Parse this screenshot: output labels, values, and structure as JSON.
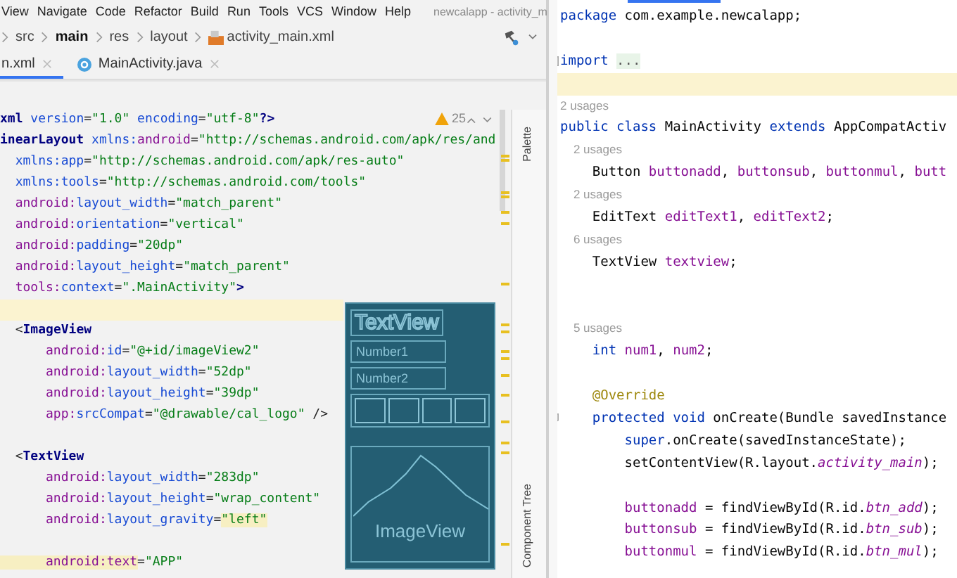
{
  "left_window": {
    "menu": [
      "View",
      "Navigate",
      "Code",
      "Refactor",
      "Build",
      "Run",
      "Tools",
      "VCS",
      "Window",
      "Help"
    ],
    "title": "newcalapp - activity_m",
    "breadcrumb": [
      {
        "label": "src",
        "emphasized": false
      },
      {
        "label": "main",
        "emphasized": true
      },
      {
        "label": "res",
        "emphasized": false
      },
      {
        "label": "layout",
        "emphasized": false
      },
      {
        "label": "activity_main.xml",
        "emphasized": false
      }
    ],
    "tabs": [
      {
        "label": "n.xml",
        "selected": true,
        "kind": "xml"
      },
      {
        "label": "MainActivity.java",
        "selected": false,
        "kind": "java"
      }
    ],
    "warnings": "25",
    "side_tools": [
      "Palette",
      "Component Tree"
    ],
    "lines": [
      {
        "kind": "code",
        "tokens": [
          {
            "text": "xml",
            "kind": "tag"
          },
          {
            "text": " version",
            "kind": "attr"
          },
          {
            "text": "=",
            "kind": "p"
          },
          {
            "text": "\"1.0\"",
            "kind": "str"
          },
          {
            "text": " encoding",
            "kind": "attr"
          },
          {
            "text": "=",
            "kind": "p"
          },
          {
            "text": "\"utf-8\"",
            "kind": "str"
          },
          {
            "text": "?>",
            "kind": "tag"
          }
        ]
      },
      {
        "kind": "code",
        "tokens": [
          {
            "text": "inearLayout",
            "kind": "tag"
          },
          {
            "text": " xmlns:",
            "kind": "attr"
          },
          {
            "text": "android",
            "kind": "ns"
          },
          {
            "text": "=",
            "kind": "p"
          },
          {
            "text": "\"http://schemas.android.com/apk/res/and",
            "kind": "str"
          }
        ]
      },
      {
        "kind": "code",
        "tokens": [
          {
            "text": "  xmlns:app",
            "kind": "attr"
          },
          {
            "text": "=",
            "kind": "p"
          },
          {
            "text": "\"http://schemas.android.com/apk/res-auto\"",
            "kind": "str"
          }
        ]
      },
      {
        "kind": "code",
        "tokens": [
          {
            "text": "  xmlns:tools",
            "kind": "attr"
          },
          {
            "text": "=",
            "kind": "p"
          },
          {
            "text": "\"http://schemas.android.com/tools\"",
            "kind": "str"
          }
        ]
      },
      {
        "kind": "code",
        "tokens": [
          {
            "text": "  android:",
            "kind": "ns"
          },
          {
            "text": "layout_width",
            "kind": "attr"
          },
          {
            "text": "=",
            "kind": "p"
          },
          {
            "text": "\"match_parent\"",
            "kind": "str"
          }
        ]
      },
      {
        "kind": "code",
        "tokens": [
          {
            "text": "  android:",
            "kind": "ns"
          },
          {
            "text": "orientation",
            "kind": "attr"
          },
          {
            "text": "=",
            "kind": "p"
          },
          {
            "text": "\"vertical\"",
            "kind": "str"
          }
        ]
      },
      {
        "kind": "code",
        "tokens": [
          {
            "text": "  android:",
            "kind": "ns"
          },
          {
            "text": "padding",
            "kind": "attr"
          },
          {
            "text": "=",
            "kind": "p"
          },
          {
            "text": "\"20dp\"",
            "kind": "str"
          }
        ]
      },
      {
        "kind": "code",
        "tokens": [
          {
            "text": "  android:",
            "kind": "ns"
          },
          {
            "text": "layout_height",
            "kind": "attr"
          },
          {
            "text": "=",
            "kind": "p"
          },
          {
            "text": "\"match_parent\"",
            "kind": "str"
          }
        ]
      },
      {
        "kind": "code",
        "tokens": [
          {
            "text": "  tools:",
            "kind": "ns"
          },
          {
            "text": "context",
            "kind": "attr"
          },
          {
            "text": "=",
            "kind": "p"
          },
          {
            "text": "\".MainActivity\"",
            "kind": "str"
          },
          {
            "text": ">",
            "kind": "tag"
          }
        ]
      },
      {
        "kind": "current"
      },
      {
        "kind": "code",
        "tokens": [
          {
            "text": "  <",
            "kind": "p"
          },
          {
            "text": "ImageView",
            "kind": "tag"
          }
        ]
      },
      {
        "kind": "code",
        "tokens": [
          {
            "text": "      android:",
            "kind": "ns"
          },
          {
            "text": "id",
            "kind": "attr"
          },
          {
            "text": "=",
            "kind": "p"
          },
          {
            "text": "\"@+id/imageView2\"",
            "kind": "str"
          }
        ]
      },
      {
        "kind": "code",
        "tokens": [
          {
            "text": "      android:",
            "kind": "ns"
          },
          {
            "text": "layout_width",
            "kind": "attr"
          },
          {
            "text": "=",
            "kind": "p"
          },
          {
            "text": "\"52dp\"",
            "kind": "str"
          }
        ]
      },
      {
        "kind": "code",
        "tokens": [
          {
            "text": "      android:",
            "kind": "ns"
          },
          {
            "text": "layout_height",
            "kind": "attr"
          },
          {
            "text": "=",
            "kind": "p"
          },
          {
            "text": "\"39dp\"",
            "kind": "str"
          }
        ]
      },
      {
        "kind": "code",
        "tokens": [
          {
            "text": "      app:",
            "kind": "ns"
          },
          {
            "text": "srcCompat",
            "kind": "attr"
          },
          {
            "text": "=",
            "kind": "p"
          },
          {
            "text": "\"@drawable/cal_logo\"",
            "kind": "str"
          },
          {
            "text": " />",
            "kind": "p"
          }
        ]
      },
      {
        "kind": "blank"
      },
      {
        "kind": "code",
        "tokens": [
          {
            "text": "  <",
            "kind": "p"
          },
          {
            "text": "TextView",
            "kind": "tag"
          }
        ]
      },
      {
        "kind": "code",
        "tokens": [
          {
            "text": "      android:",
            "kind": "ns"
          },
          {
            "text": "layout_width",
            "kind": "attr"
          },
          {
            "text": "=",
            "kind": "p"
          },
          {
            "text": "\"283dp\"",
            "kind": "str"
          }
        ]
      },
      {
        "kind": "code",
        "tokens": [
          {
            "text": "      android:",
            "kind": "ns"
          },
          {
            "text": "layout_height",
            "kind": "attr"
          },
          {
            "text": "=",
            "kind": "p"
          },
          {
            "text": "\"wrap_content\"",
            "kind": "str"
          }
        ]
      },
      {
        "kind": "code",
        "tokens": [
          {
            "text": "      android:",
            "kind": "ns"
          },
          {
            "text": "layout_gravity",
            "kind": "attr"
          },
          {
            "text": "=",
            "kind": "p"
          },
          {
            "text": "\"left\"",
            "kind": "hl"
          }
        ]
      },
      {
        "kind": "blank"
      },
      {
        "kind": "code",
        "tokens": [
          {
            "text": "      android:text",
            "kind": "hlattr"
          },
          {
            "text": "=",
            "kind": "p"
          },
          {
            "text": "\"APP\"",
            "kind": "str"
          }
        ]
      }
    ],
    "preview": {
      "title": "TextView",
      "fields": [
        "Number1",
        "Number2"
      ],
      "image_label": "ImageView"
    }
  },
  "right_editor": {
    "lines": [
      {
        "kind": "code",
        "tokens": [
          {
            "text": "package",
            "kind": "kw"
          },
          {
            "text": " com.example.newcalapp;",
            "kind": "plain"
          }
        ]
      },
      {
        "kind": "blank"
      },
      {
        "kind": "code",
        "tokens": [
          {
            "text": "import ",
            "kind": "kw"
          },
          {
            "text": "...",
            "kind": "fold"
          }
        ]
      },
      {
        "kind": "current"
      },
      {
        "kind": "usages",
        "text": "2 usages"
      },
      {
        "kind": "code",
        "tokens": [
          {
            "text": "public class",
            "kind": "kw"
          },
          {
            "text": " MainActivity ",
            "kind": "plain"
          },
          {
            "text": "extends",
            "kind": "kw"
          },
          {
            "text": " AppCompatActiv",
            "kind": "plain"
          }
        ]
      },
      {
        "kind": "usages",
        "text": "    2 usages"
      },
      {
        "kind": "code",
        "tokens": [
          {
            "text": "    Button ",
            "kind": "plain"
          },
          {
            "text": "buttonadd",
            "kind": "field"
          },
          {
            "text": ", ",
            "kind": "plain"
          },
          {
            "text": "buttonsub",
            "kind": "field"
          },
          {
            "text": ", ",
            "kind": "plain"
          },
          {
            "text": "buttonmul",
            "kind": "field"
          },
          {
            "text": ", ",
            "kind": "plain"
          },
          {
            "text": "butt",
            "kind": "field"
          }
        ]
      },
      {
        "kind": "usages",
        "text": "    2 usages"
      },
      {
        "kind": "code",
        "tokens": [
          {
            "text": "    EditText ",
            "kind": "plain"
          },
          {
            "text": "editText1",
            "kind": "field"
          },
          {
            "text": ", ",
            "kind": "plain"
          },
          {
            "text": "editText2",
            "kind": "field"
          },
          {
            "text": ";",
            "kind": "plain"
          }
        ]
      },
      {
        "kind": "usages",
        "text": "    6 usages"
      },
      {
        "kind": "code",
        "tokens": [
          {
            "text": "    TextView ",
            "kind": "plain"
          },
          {
            "text": "textview",
            "kind": "field"
          },
          {
            "text": ";",
            "kind": "plain"
          }
        ]
      },
      {
        "kind": "blank"
      },
      {
        "kind": "blank"
      },
      {
        "kind": "usages",
        "text": "    5 usages"
      },
      {
        "kind": "code",
        "tokens": [
          {
            "text": "    int ",
            "kind": "kw"
          },
          {
            "text": "num1",
            "kind": "field"
          },
          {
            "text": ", ",
            "kind": "plain"
          },
          {
            "text": "num2",
            "kind": "field"
          },
          {
            "text": ";",
            "kind": "plain"
          }
        ]
      },
      {
        "kind": "blank"
      },
      {
        "kind": "code",
        "tokens": [
          {
            "text": "    @Override",
            "kind": "ann"
          }
        ]
      },
      {
        "kind": "code",
        "tokens": [
          {
            "text": "    protected void",
            "kind": "kw"
          },
          {
            "text": " onCreate(Bundle savedInstance",
            "kind": "plain"
          }
        ]
      },
      {
        "kind": "code",
        "tokens": [
          {
            "text": "        super",
            "kind": "kw"
          },
          {
            "text": ".onCreate(savedInstanceState);",
            "kind": "plain"
          }
        ]
      },
      {
        "kind": "code",
        "tokens": [
          {
            "text": "        setContentView(R.layout.",
            "kind": "plain"
          },
          {
            "text": "activity_main",
            "kind": "static"
          },
          {
            "text": ");",
            "kind": "plain"
          }
        ]
      },
      {
        "kind": "blank"
      },
      {
        "kind": "code",
        "tokens": [
          {
            "text": "        buttonadd",
            "kind": "field"
          },
          {
            "text": " = findViewById(R.id.",
            "kind": "plain"
          },
          {
            "text": "btn_add",
            "kind": "static"
          },
          {
            "text": ");",
            "kind": "plain"
          }
        ]
      },
      {
        "kind": "code",
        "tokens": [
          {
            "text": "        buttonsub",
            "kind": "field"
          },
          {
            "text": " = findViewById(R.id.",
            "kind": "plain"
          },
          {
            "text": "btn_sub",
            "kind": "static"
          },
          {
            "text": ");",
            "kind": "plain"
          }
        ]
      },
      {
        "kind": "code",
        "tokens": [
          {
            "text": "        buttonmul",
            "kind": "field"
          },
          {
            "text": " = findViewById(R.id.",
            "kind": "plain"
          },
          {
            "text": "btn_mul",
            "kind": "static"
          },
          {
            "text": ");",
            "kind": "plain"
          }
        ]
      }
    ]
  }
}
